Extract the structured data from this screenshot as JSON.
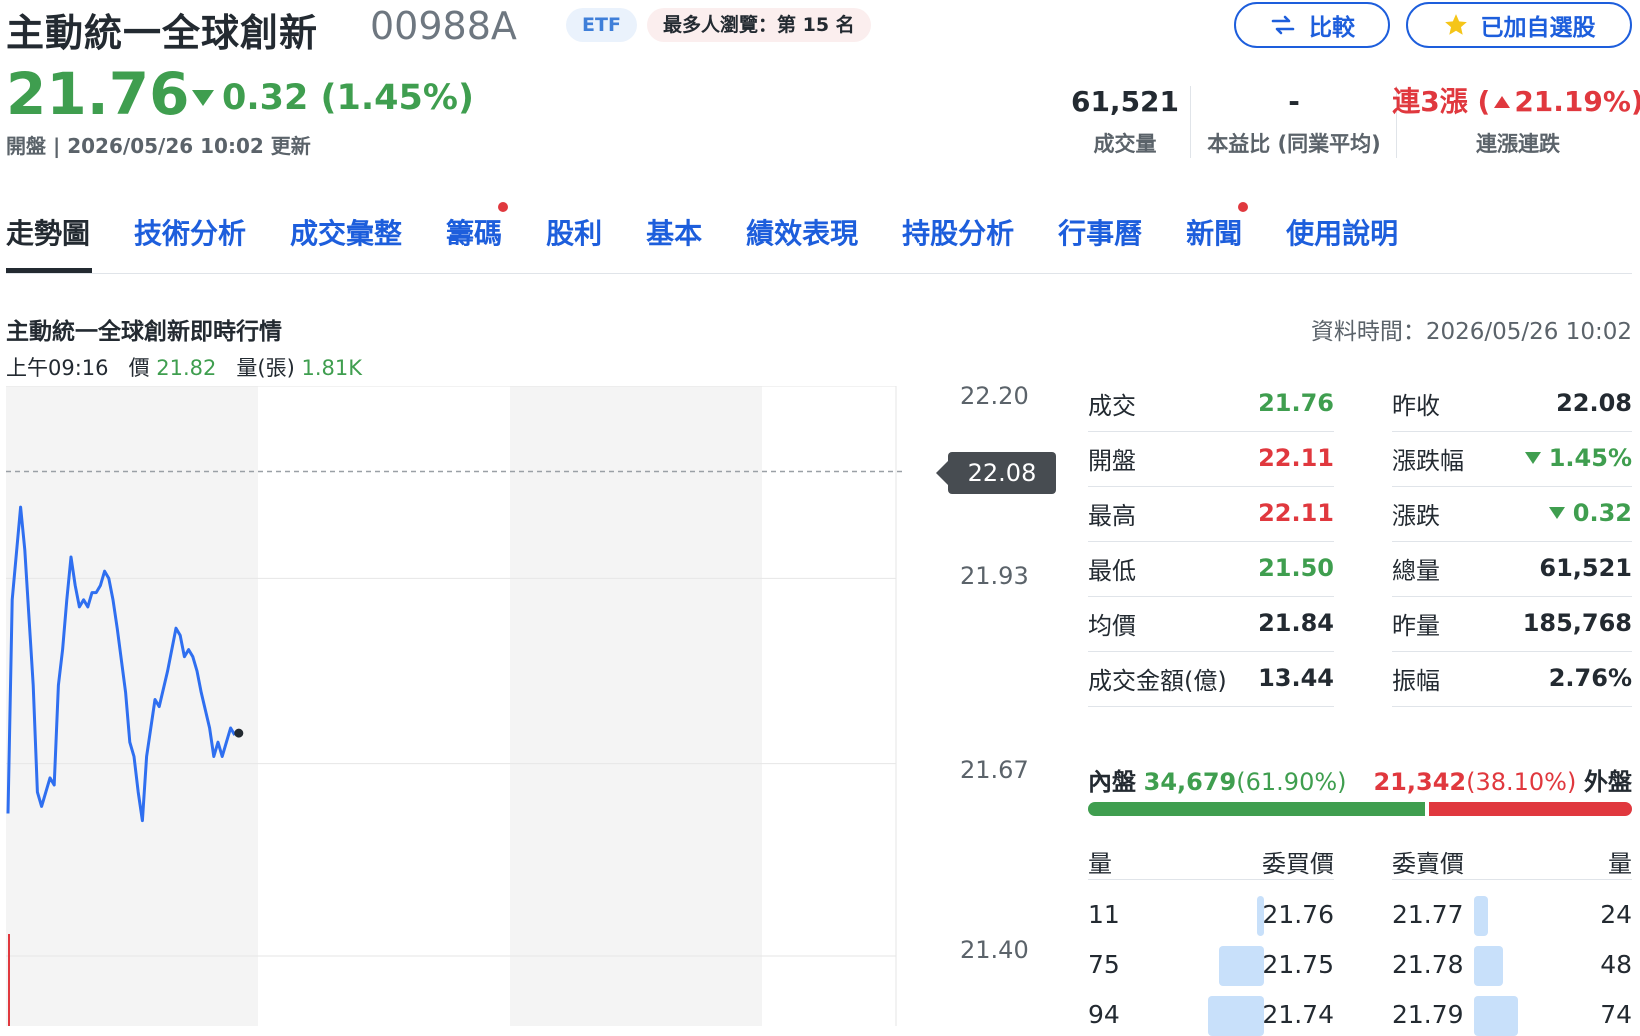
{
  "header": {
    "name": "主動統一全球創新",
    "symbol": "00988A",
    "etf_badge": "ETF",
    "rank_badge": "最多人瀏覽：第 15 名",
    "compare_label": "比較",
    "watchlist_label": "已加自選股",
    "price": "21.76",
    "change": "0.32 (1.45%)",
    "update": "開盤 | 2026/05/26 10:02 更新"
  },
  "stats": {
    "volume_value": "61,521",
    "volume_label": "成交量",
    "pe_value": "-",
    "pe_label": "本益比 (同業平均)",
    "streak_prefix": "連3漲 (",
    "streak_value": "21.19%)",
    "streak_label": "連漲連跌"
  },
  "tabs": [
    {
      "label": "走勢圖"
    },
    {
      "label": "技術分析"
    },
    {
      "label": "成交彙整"
    },
    {
      "label": "籌碼"
    },
    {
      "label": "股利"
    },
    {
      "label": "基本"
    },
    {
      "label": "績效表現"
    },
    {
      "label": "持股分析"
    },
    {
      "label": "行事曆"
    },
    {
      "label": "新聞"
    },
    {
      "label": "使用說明"
    }
  ],
  "section": {
    "title": "主動統一全球創新即時行情",
    "data_time": "資料時間：2026/05/26 10:02",
    "hover_time": "上午09:16",
    "hover_price_label": "價",
    "hover_price": "21.82",
    "hover_vol_label": "量(張)",
    "hover_vol": "1.81K"
  },
  "chart_data": {
    "type": "line",
    "title": "",
    "ylim": [
      21.4,
      22.2
    ],
    "yticks": [
      "22.20",
      "21.93",
      "21.67",
      "21.40"
    ],
    "reference_price": "22.08",
    "session": "09:00-13:30",
    "x_minutes_since_open": [
      0,
      1,
      3,
      4,
      6,
      7,
      8,
      10,
      11,
      12,
      13,
      14,
      15,
      16,
      17,
      18,
      19,
      20,
      21,
      22,
      23,
      24,
      25,
      26,
      28,
      29,
      30,
      31,
      32,
      33,
      34,
      35,
      36,
      38,
      39,
      40,
      41,
      42,
      43,
      44,
      45,
      46,
      48,
      49,
      50,
      51,
      52,
      53,
      54
    ],
    "y": [
      21.6,
      21.9,
      22.03,
      21.97,
      21.78,
      21.63,
      21.61,
      21.65,
      21.64,
      21.78,
      21.83,
      21.9,
      21.96,
      21.92,
      21.89,
      21.9,
      21.89,
      21.91,
      21.91,
      21.92,
      21.94,
      21.93,
      21.9,
      21.86,
      21.77,
      21.7,
      21.68,
      21.63,
      21.59,
      21.68,
      21.72,
      21.76,
      21.75,
      21.8,
      21.83,
      21.86,
      21.85,
      21.82,
      21.83,
      21.82,
      21.8,
      21.77,
      21.72,
      21.68,
      21.7,
      21.68,
      21.7,
      21.72,
      21.71
    ]
  },
  "quote": {
    "left": [
      {
        "label": "成交",
        "value": "21.76",
        "color": "#3f9e4f"
      },
      {
        "label": "開盤",
        "value": "22.11",
        "color": "#e0383e"
      },
      {
        "label": "最高",
        "value": "22.11",
        "color": "#e0383e"
      },
      {
        "label": "最低",
        "value": "21.50",
        "color": "#3f9e4f"
      },
      {
        "label": "均價",
        "value": "21.84",
        "color": "#232a31"
      },
      {
        "label": "成交金額(億)",
        "value": "13.44",
        "color": "#232a31"
      }
    ],
    "right": [
      {
        "label": "昨收",
        "value": "22.08",
        "color": "#232a31",
        "arrow": ""
      },
      {
        "label": "漲跌幅",
        "value": "1.45%",
        "color": "#3f9e4f",
        "arrow": "down"
      },
      {
        "label": "漲跌",
        "value": "0.32",
        "color": "#3f9e4f",
        "arrow": "down"
      },
      {
        "label": "總量",
        "value": "61,521",
        "color": "#232a31",
        "arrow": ""
      },
      {
        "label": "昨量",
        "value": "185,768",
        "color": "#232a31",
        "arrow": ""
      },
      {
        "label": "振幅",
        "value": "2.76%",
        "color": "#232a31",
        "arrow": ""
      }
    ]
  },
  "inout": {
    "inner_label": "內盤",
    "inner_value": "34,679",
    "inner_pct": "(61.90%)",
    "outer_value": "21,342",
    "outer_pct": "(38.10%)",
    "outer_label": "外盤",
    "inner_share": 0.619,
    "outer_share": 0.381
  },
  "orderbook": {
    "headers": {
      "bid_vol": "量",
      "bid_price": "委買價",
      "ask_price": "委賣價",
      "ask_vol": "量"
    },
    "rows": [
      {
        "bid_vol": "11",
        "bid_price": "21.76",
        "ask_price": "21.77",
        "ask_vol": "24"
      },
      {
        "bid_vol": "75",
        "bid_price": "21.75",
        "ask_price": "21.78",
        "ask_vol": "48"
      },
      {
        "bid_vol": "94",
        "bid_price": "21.74",
        "ask_price": "21.79",
        "ask_vol": "74"
      }
    ]
  },
  "colors": {
    "up": "#e0383e",
    "down": "#3f9e4f",
    "link": "#1d5edc",
    "line": "#2f6ff0"
  }
}
